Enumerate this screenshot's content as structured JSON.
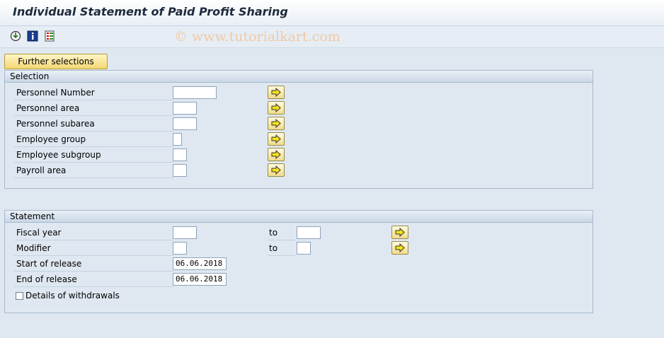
{
  "window": {
    "title": "Individual Statement of Paid Profit Sharing"
  },
  "toolbar": {
    "icons": [
      "execute-icon",
      "info-icon",
      "selection-options-icon"
    ]
  },
  "watermark": "© www.tutorialkart.com",
  "further_selections_label": "Further selections",
  "selection": {
    "title": "Selection",
    "rows": [
      {
        "label": "Personnel Number",
        "value": ""
      },
      {
        "label": "Personnel area",
        "value": ""
      },
      {
        "label": "Personnel subarea",
        "value": ""
      },
      {
        "label": "Employee group",
        "value": ""
      },
      {
        "label": "Employee subgroup",
        "value": ""
      },
      {
        "label": "Payroll area",
        "value": ""
      }
    ]
  },
  "statement": {
    "title": "Statement",
    "fiscal_year": {
      "label": "Fiscal year",
      "from": "",
      "to_label": "to",
      "to": ""
    },
    "modifier": {
      "label": "Modifier",
      "from": "",
      "to_label": "to",
      "to": ""
    },
    "start_of_release": {
      "label": "Start of release",
      "value": "06.06.2018"
    },
    "end_of_release": {
      "label": "End of release",
      "value": "06.06.2018"
    },
    "details_of_withdrawals": {
      "label": "Details of withdrawals",
      "checked": false
    }
  }
}
